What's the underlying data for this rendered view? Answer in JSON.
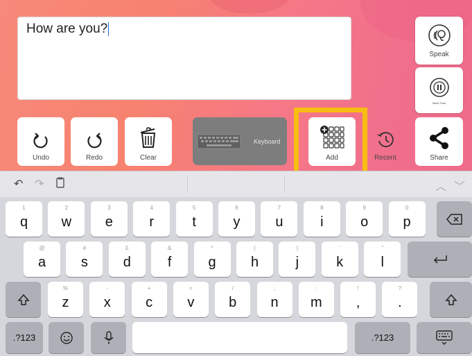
{
  "composer": {
    "text": "How are you?"
  },
  "side_buttons": {
    "speak": "Speak",
    "need_time": "Need Time"
  },
  "toolbar": {
    "undo": "Undo",
    "redo": "Redo",
    "clear": "Clear",
    "keyboard": "Keyboard",
    "add": "Add",
    "recent": "Recent",
    "share": "Share"
  },
  "keyboard": {
    "row1": [
      {
        "hint": "1",
        "key": "q"
      },
      {
        "hint": "2",
        "key": "w"
      },
      {
        "hint": "3",
        "key": "e"
      },
      {
        "hint": "4",
        "key": "r"
      },
      {
        "hint": "5",
        "key": "t"
      },
      {
        "hint": "6",
        "key": "y"
      },
      {
        "hint": "7",
        "key": "u"
      },
      {
        "hint": "8",
        "key": "i"
      },
      {
        "hint": "9",
        "key": "o"
      },
      {
        "hint": "0",
        "key": "p"
      }
    ],
    "row2": [
      {
        "hint": "@",
        "key": "a"
      },
      {
        "hint": "#",
        "key": "s"
      },
      {
        "hint": "£",
        "key": "d"
      },
      {
        "hint": "&",
        "key": "f"
      },
      {
        "hint": "*",
        "key": "g"
      },
      {
        "hint": "(",
        "key": "h"
      },
      {
        "hint": ")",
        "key": "j"
      },
      {
        "hint": "'",
        "key": "k"
      },
      {
        "hint": "\"",
        "key": "l"
      }
    ],
    "row3": [
      {
        "hint": "%",
        "key": "z"
      },
      {
        "hint": "-",
        "key": "x"
      },
      {
        "hint": "+",
        "key": "c"
      },
      {
        "hint": "=",
        "key": "v"
      },
      {
        "hint": "/",
        "key": "b"
      },
      {
        "hint": ";",
        "key": "n"
      },
      {
        "hint": ":",
        "key": "m"
      },
      {
        "hint": "!",
        "key": ","
      },
      {
        "hint": "?",
        "key": "."
      }
    ],
    "num_left": ".?123",
    "num_right": ".?123"
  },
  "colors": {
    "highlight": "#f7bd12",
    "app_bg": "#f7826f",
    "keyboard_button": "#7d7d7d"
  }
}
